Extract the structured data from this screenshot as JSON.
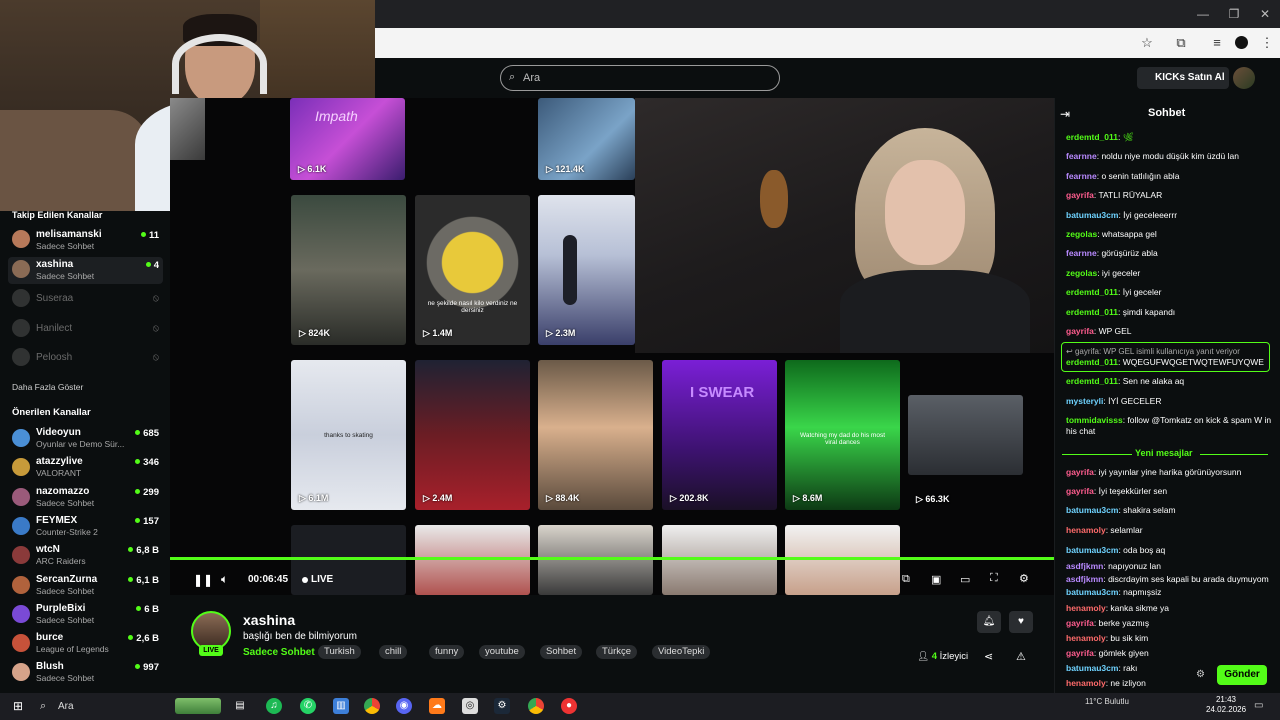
{
  "browser": {
    "search_placeholder": "Ara",
    "kicks_label": "KICKs Satın Al"
  },
  "sidebar": {
    "followed_title": "Takip Edilen Kanallar",
    "followed": [
      {
        "name": "melisamanski",
        "category": "Sadece Sohbet",
        "viewers": "11",
        "online": true
      },
      {
        "name": "xashina",
        "category": "Sadece Sohbet",
        "viewers": "4",
        "online": true
      },
      {
        "name": "Suseraa",
        "category": "",
        "viewers": "",
        "online": false
      },
      {
        "name": "Hanilect",
        "category": "",
        "viewers": "",
        "online": false
      },
      {
        "name": "Peloosh",
        "category": "",
        "viewers": "",
        "online": false
      }
    ],
    "show_more": "Daha Fazla Göster",
    "recommended_title": "Önerilen Kanallar",
    "recommended": [
      {
        "name": "Videoyun",
        "category": "Oyunlar ve Demo Sür...",
        "viewers": "685"
      },
      {
        "name": "atazzylive",
        "category": "VALORANT",
        "viewers": "346"
      },
      {
        "name": "nazomazzo",
        "category": "Sadece Sohbet",
        "viewers": "299"
      },
      {
        "name": "FEYMEX",
        "category": "Counter-Strike 2",
        "viewers": "157"
      },
      {
        "name": "wtcN",
        "category": "ARC Raiders",
        "viewers": "6,8 B"
      },
      {
        "name": "SercanZurna",
        "category": "Sadece Sohbet",
        "viewers": "6,1 B"
      },
      {
        "name": "PurpleBixi",
        "category": "Sadece Sohbet",
        "viewers": "6 B"
      },
      {
        "name": "burce",
        "category": "League of Legends",
        "viewers": "2,6 B"
      },
      {
        "name": "Blush",
        "category": "Sadece Sohbet",
        "viewers": "997"
      }
    ]
  },
  "video": {
    "tiles_row1": [
      "6.1K",
      "121.4K"
    ],
    "tiles_row2": [
      "824K",
      "1.4M",
      "2.3M"
    ],
    "tiles_row3": [
      "6.1M",
      "2.4M",
      "88.4K",
      "202.8K",
      "8.6M",
      "66.3K"
    ],
    "tile_captions": {
      "impath": "Impath",
      "food": "ne şekilde nasıl kilo verdiniz ne dersiniz",
      "skating": "thanks to skating",
      "iswear": "I SWEAR",
      "viral": "Watching my dad do his most viral dances"
    },
    "controls": {
      "time": "00:06:45",
      "live": "LIVE"
    }
  },
  "stream": {
    "streamer": "xashina",
    "title": "başlığı ben de bilmiyorum",
    "category": "Sadece Sohbet",
    "live_badge": "LIVE",
    "tags": [
      "Turkish",
      "chill",
      "funny",
      "youtube",
      "Sohbet",
      "Türkçe",
      "VideoTepki"
    ],
    "viewers": "4",
    "viewers_label": "İzleyici"
  },
  "chat": {
    "title": "Sohbet",
    "messages": [
      {
        "user": "erdemtd_011",
        "color": "#53fc18",
        "text": ""
      },
      {
        "user": "fearnne",
        "color": "#b98aff",
        "text": "noldu niye modu düşük kim üzdü lan"
      },
      {
        "user": "fearnne",
        "color": "#b98aff",
        "text": "o senin tatlılığın abla"
      },
      {
        "user": "gayrifa",
        "color": "#ff5d8f",
        "text": "TATLI RÜYALAR"
      },
      {
        "user": "batumau3cm",
        "color": "#6fd3ff",
        "text": "İyi geceleeerrr"
      },
      {
        "user": "zegolas",
        "color": "#53fc18",
        "text": "whatsappa gel"
      },
      {
        "user": "fearnne",
        "color": "#b98aff",
        "text": "görüşürüz abla"
      },
      {
        "user": "zegolas",
        "color": "#53fc18",
        "text": "iyi geceler"
      },
      {
        "user": "erdemtd_011",
        "color": "#53fc18",
        "text": "İyi geceler"
      },
      {
        "user": "erdemtd_011",
        "color": "#53fc18",
        "text": "şimdi kapandı"
      },
      {
        "user": "gayrifa",
        "color": "#ff5d8f",
        "text": "WP GEL"
      }
    ],
    "reply": {
      "quoted": "gayrifa: WP GEL isimli kullanıcıya yanıt veriyor",
      "user": "erdemtd_011",
      "color": "#53fc18",
      "text": "WQEGUFWQGETWQTEWFUYQWE"
    },
    "messages2": [
      {
        "user": "erdemtd_011",
        "color": "#53fc18",
        "text": "Sen ne alaka aq"
      },
      {
        "user": "mysteryli",
        "color": "#6fd3ff",
        "text": "İYİ GECELER"
      },
      {
        "user": "tommidavisss",
        "color": "#53fc18",
        "text": "follow @Tomkatz on kick & spam W in his chat"
      }
    ],
    "new_messages": "Yeni mesajlar",
    "messages3": [
      {
        "user": "gayrifa",
        "color": "#ff5d8f",
        "text": "iyi yayınlar yine harika görünüyorsunn"
      },
      {
        "user": "gayrifa",
        "color": "#ff5d8f",
        "text": "İyi teşekkürler sen"
      },
      {
        "user": "batumau3cm",
        "color": "#6fd3ff",
        "text": "shakira selam"
      },
      {
        "user": "henamoly",
        "color": "#ff6b6b",
        "text": "selamlar"
      },
      {
        "user": "batumau3cm",
        "color": "#6fd3ff",
        "text": "oda boş aq"
      },
      {
        "user": "asdfjkmn",
        "color": "#b98aff",
        "text": "napıyonuz lan"
      },
      {
        "user": "asdfjkmn",
        "color": "#b98aff",
        "text": "discrdayim ses kapali bu arada duymuyom"
      },
      {
        "user": "batumau3cm",
        "color": "#6fd3ff",
        "text": "napmışsiz"
      },
      {
        "user": "henamoly",
        "color": "#ff6b6b",
        "text": "kanka sikme ya"
      },
      {
        "user": "gayrifa",
        "color": "#ff5d8f",
        "text": "berke yazmış"
      },
      {
        "user": "henamoly",
        "color": "#ff6b6b",
        "text": "bu sik kim"
      },
      {
        "user": "gayrifa",
        "color": "#ff5d8f",
        "text": "gömlek giyen"
      },
      {
        "user": "batumau3cm",
        "color": "#6fd3ff",
        "text": "rakı"
      },
      {
        "user": "henamoly",
        "color": "#ff6b6b",
        "text": "ne izliyon"
      }
    ],
    "send_label": "Gönder"
  },
  "taskbar": {
    "search": "Ara",
    "time": "21:43",
    "date": "24.02.2026",
    "weather": "11°C Bulutlu"
  }
}
